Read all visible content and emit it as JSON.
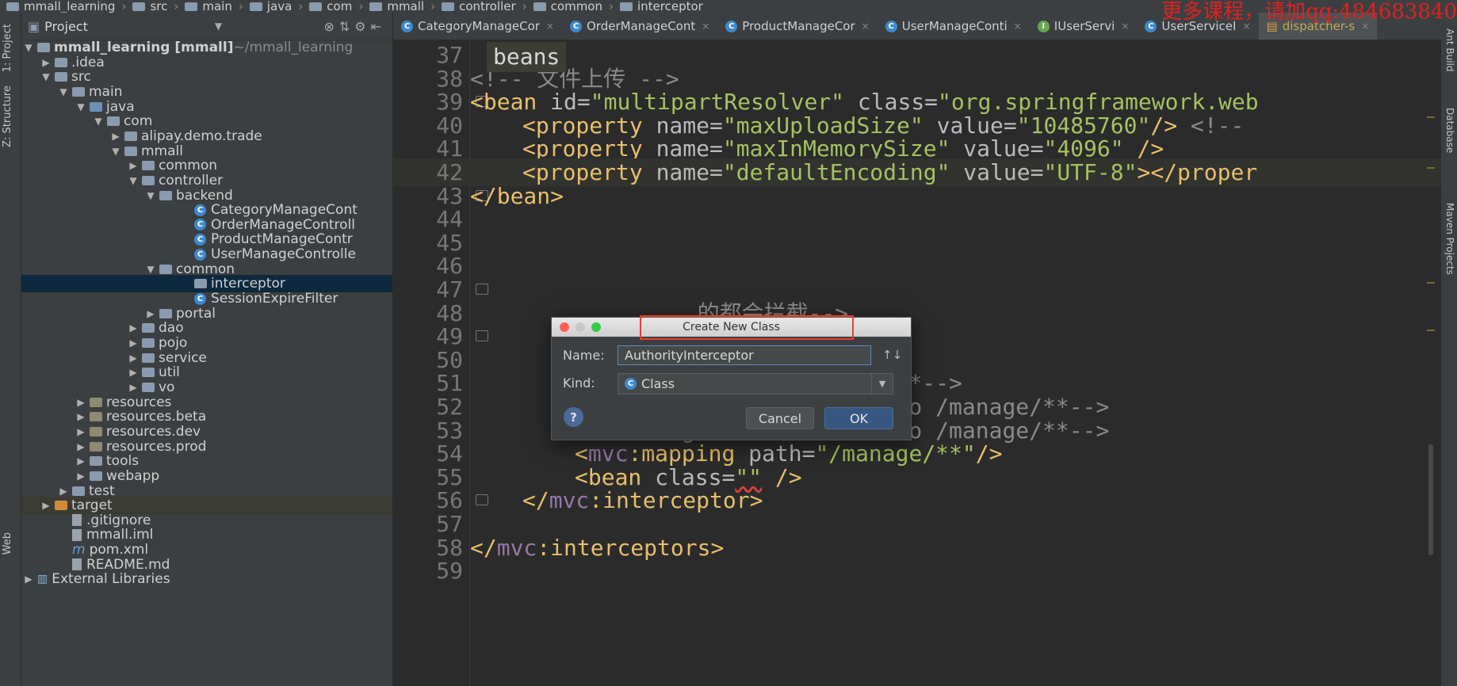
{
  "breadcrumb": [
    "mmall_learning",
    "src",
    "main",
    "java",
    "com",
    "mmall",
    "controller",
    "common",
    "interceptor"
  ],
  "watermark": "更多课程，请加qq:484683840",
  "tool_windows": {
    "project": "1: Project",
    "structure": "Z: Structure",
    "web": "Web",
    "ant_build": "Ant Build",
    "database": "Database",
    "maven": "Maven Projects"
  },
  "project_panel": {
    "title": "Project",
    "tree": [
      {
        "label": "mmall_learning [mmall]",
        "suffix": " ~/mmall_learning",
        "depth": 0,
        "icon": "folder",
        "open": true
      },
      {
        "label": ".idea",
        "depth": 1,
        "icon": "folder",
        "open": false
      },
      {
        "label": "src",
        "depth": 1,
        "icon": "folder",
        "open": true
      },
      {
        "label": "main",
        "depth": 2,
        "icon": "folder",
        "open": true
      },
      {
        "label": "java",
        "depth": 3,
        "icon": "source-folder",
        "open": true
      },
      {
        "label": "com",
        "depth": 4,
        "icon": "package",
        "open": true
      },
      {
        "label": "alipay.demo.trade",
        "depth": 5,
        "icon": "package",
        "open": false
      },
      {
        "label": "mmall",
        "depth": 5,
        "icon": "package",
        "open": true
      },
      {
        "label": "common",
        "depth": 6,
        "icon": "package",
        "open": false
      },
      {
        "label": "controller",
        "depth": 6,
        "icon": "package",
        "open": true
      },
      {
        "label": "backend",
        "depth": 7,
        "icon": "package",
        "open": true
      },
      {
        "label": "CategoryManageCont",
        "depth": 9,
        "icon": "class"
      },
      {
        "label": "OrderManageControll",
        "depth": 9,
        "icon": "class"
      },
      {
        "label": "ProductManageContr",
        "depth": 9,
        "icon": "class"
      },
      {
        "label": "UserManageControlle",
        "depth": 9,
        "icon": "class"
      },
      {
        "label": "common",
        "depth": 7,
        "icon": "package",
        "open": true
      },
      {
        "label": "interceptor",
        "depth": 9,
        "icon": "package",
        "selected": true
      },
      {
        "label": "SessionExpireFilter",
        "depth": 9,
        "icon": "class"
      },
      {
        "label": "portal",
        "depth": 7,
        "icon": "package",
        "open": false
      },
      {
        "label": "dao",
        "depth": 6,
        "icon": "package",
        "open": false
      },
      {
        "label": "pojo",
        "depth": 6,
        "icon": "package",
        "open": false
      },
      {
        "label": "service",
        "depth": 6,
        "icon": "package",
        "open": false
      },
      {
        "label": "util",
        "depth": 6,
        "icon": "package",
        "open": false
      },
      {
        "label": "vo",
        "depth": 6,
        "icon": "package",
        "open": false
      },
      {
        "label": "resources",
        "depth": 3,
        "icon": "resource-folder",
        "open": false
      },
      {
        "label": "resources.beta",
        "depth": 3,
        "icon": "resource-folder",
        "open": false
      },
      {
        "label": "resources.dev",
        "depth": 3,
        "icon": "resource-folder",
        "open": false
      },
      {
        "label": "resources.prod",
        "depth": 3,
        "icon": "resource-folder",
        "open": false
      },
      {
        "label": "tools",
        "depth": 3,
        "icon": "folder",
        "open": false
      },
      {
        "label": "webapp",
        "depth": 3,
        "icon": "folder",
        "open": false
      },
      {
        "label": "test",
        "depth": 2,
        "icon": "folder",
        "open": false
      },
      {
        "label": "target",
        "depth": 1,
        "icon": "excluded-folder",
        "open": false,
        "target": true
      },
      {
        "label": ".gitignore",
        "depth": 2,
        "icon": "file"
      },
      {
        "label": "mmall.iml",
        "depth": 2,
        "icon": "file"
      },
      {
        "label": "pom.xml",
        "depth": 2,
        "icon": "maven"
      },
      {
        "label": "README.md",
        "depth": 2,
        "icon": "file"
      },
      {
        "label": "External Libraries",
        "depth": 0,
        "icon": "library",
        "open": false
      }
    ]
  },
  "tabs": [
    {
      "label": "CategoryManageCor",
      "icon": "class"
    },
    {
      "label": "OrderManageCont",
      "icon": "class"
    },
    {
      "label": "ProductManageCor",
      "icon": "class"
    },
    {
      "label": "UserManageConti",
      "icon": "class"
    },
    {
      "label": "IUserServi",
      "icon": "interface"
    },
    {
      "label": "UserServiceI",
      "icon": "class"
    },
    {
      "label": "dispatcher-s",
      "icon": "xml",
      "active": true
    }
  ],
  "editor": {
    "crumb": "beans",
    "lines": [
      {
        "n": "37",
        "tokens": []
      },
      {
        "n": "38",
        "indent": 0,
        "tokens": [
          [
            "com",
            "<!-- 文件上传 -->"
          ]
        ]
      },
      {
        "n": "39",
        "indent": 0,
        "fold": true,
        "tokens": [
          [
            "tag",
            "<bean"
          ],
          [
            "attr",
            " id="
          ],
          [
            "val",
            "\"multipartResolver\""
          ],
          [
            "attr",
            " class="
          ],
          [
            "val",
            "\"org.springframework.web"
          ]
        ]
      },
      {
        "n": "40",
        "indent": 2,
        "tokens": [
          [
            "tag",
            "<property"
          ],
          [
            "attr",
            " name="
          ],
          [
            "val",
            "\"maxUploadSize\""
          ],
          [
            "attr",
            " value="
          ],
          [
            "val",
            "\"10485760\""
          ],
          [
            "tag",
            "/>"
          ],
          [
            "com",
            " <!--"
          ]
        ]
      },
      {
        "n": "41",
        "indent": 2,
        "tokens": [
          [
            "tag",
            "<property"
          ],
          [
            "attr",
            " name="
          ],
          [
            "val",
            "\"maxInMemorySize\""
          ],
          [
            "attr",
            " value="
          ],
          [
            "val",
            "\"4096\""
          ],
          [
            "tag",
            " />"
          ]
        ]
      },
      {
        "n": "42",
        "indent": 2,
        "hl": true,
        "tokens": [
          [
            "tag",
            "<property"
          ],
          [
            "attr",
            " name="
          ],
          [
            "val",
            "\"defaultEncoding\""
          ],
          [
            "attr",
            " value="
          ],
          [
            "val",
            "\"UTF-8\""
          ],
          [
            "tag",
            "></proper"
          ]
        ]
      },
      {
        "n": "43",
        "indent": 0,
        "fold": true,
        "tokens": [
          [
            "tag",
            "</bean>"
          ]
        ]
      },
      {
        "n": "44",
        "tokens": []
      },
      {
        "n": "45",
        "tokens": []
      },
      {
        "n": "46",
        "tokens": []
      },
      {
        "n": "47",
        "fold": true,
        "tokens": []
      },
      {
        "n": "48",
        "indent": 0,
        "tokens": [
          [
            "com",
            "                 的都会拦截-->"
          ]
        ]
      },
      {
        "n": "49",
        "fold": true,
        "tokens": []
      },
      {
        "n": "50",
        "indent": 0,
        "tokens": [
          [
            "com",
            "            /manage/*-->"
          ]
        ]
      },
      {
        "n": "51",
        "indent": 4,
        "tokens": [
          [
            "com",
            "<!--manage/b.do  /manage/*-->"
          ]
        ]
      },
      {
        "n": "52",
        "indent": 4,
        "tokens": [
          [
            "com",
            "<!--manage/product/save.do /manage/**-->"
          ]
        ]
      },
      {
        "n": "53",
        "indent": 4,
        "tokens": [
          [
            "com",
            "<!--manage/order/detail.do /manage/**-->"
          ]
        ]
      },
      {
        "n": "54",
        "indent": 4,
        "tokens": [
          [
            "tag",
            "<"
          ],
          [
            "ns",
            "mvc"
          ],
          [
            "tag",
            ":mapping"
          ],
          [
            "attr",
            " path="
          ],
          [
            "val",
            "\"/manage/**\""
          ],
          [
            "tag",
            "/>"
          ]
        ]
      },
      {
        "n": "55",
        "indent": 4,
        "tokens": [
          [
            "tag",
            "<bean"
          ],
          [
            "attr",
            " class="
          ],
          [
            "err",
            "\"\""
          ],
          [
            "tag",
            " />"
          ]
        ]
      },
      {
        "n": "56",
        "indent": 2,
        "fold": true,
        "tokens": [
          [
            "tag",
            "</"
          ],
          [
            "ns",
            "mvc"
          ],
          [
            "tag",
            ":interceptor>"
          ]
        ]
      },
      {
        "n": "57",
        "tokens": []
      },
      {
        "n": "58",
        "indent": 0,
        "tokens": [
          [
            "tag",
            "</"
          ],
          [
            "ns",
            "mvc"
          ],
          [
            "tag",
            ":interceptors>"
          ]
        ]
      },
      {
        "n": "59",
        "tokens": []
      }
    ]
  },
  "dialog": {
    "title": "Create New Class",
    "name_label": "Name:",
    "name_value": "AuthorityInterceptor",
    "kind_label": "Kind:",
    "kind_value": "Class",
    "help": "?",
    "cancel": "Cancel",
    "ok": "OK"
  },
  "colors": {
    "accent_red": "#e8402f",
    "selection": "#0d293e",
    "ok_button": "#365880"
  }
}
